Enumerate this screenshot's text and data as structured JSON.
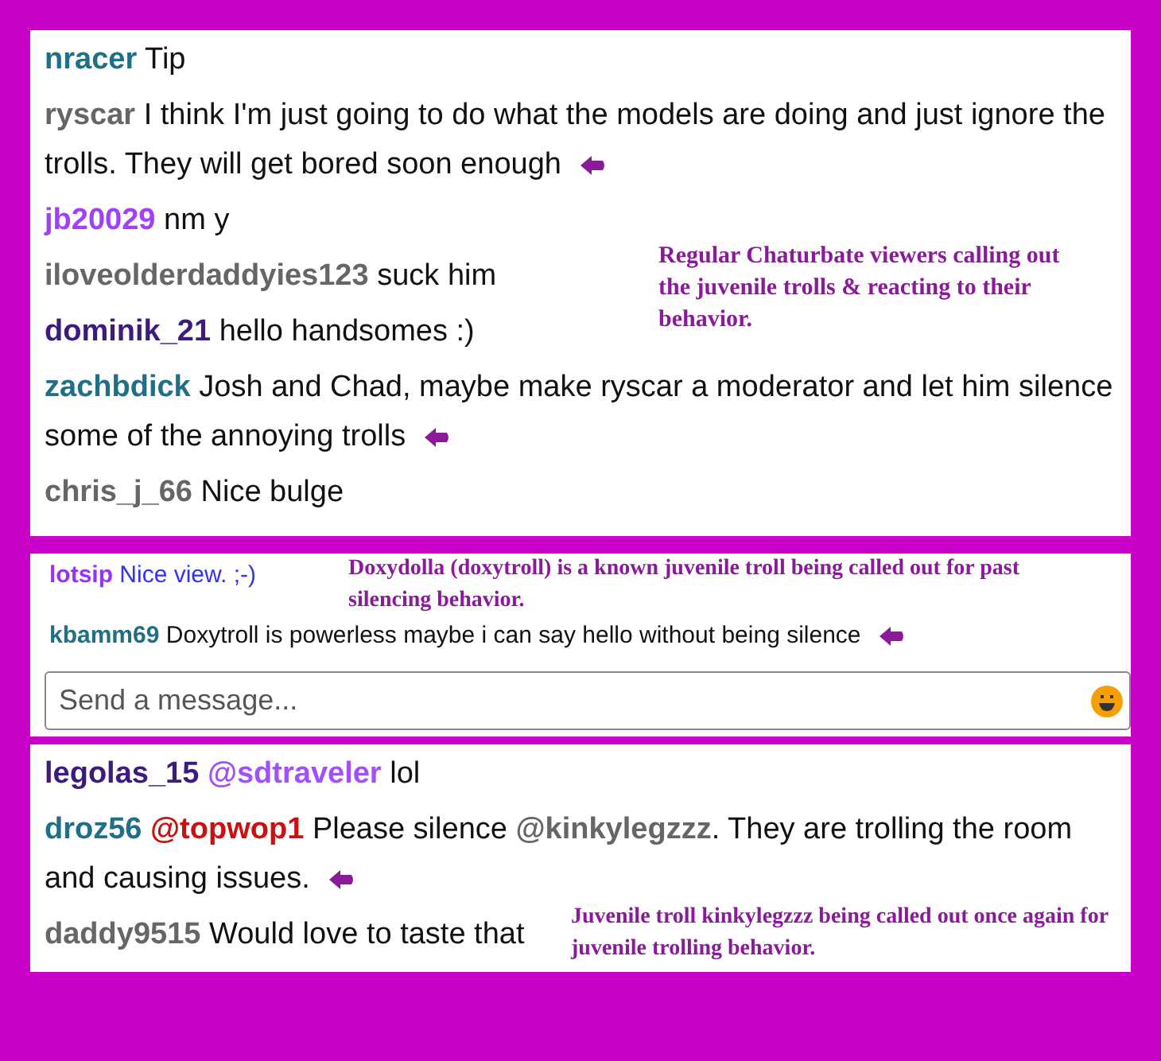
{
  "panels": [
    {
      "messages": [
        {
          "user": "nracer",
          "color": "#1f6f86",
          "parts": [
            {
              "kind": "plain",
              "text": "Tip"
            }
          ],
          "arrow": false
        },
        {
          "user": "ryscar",
          "color": "#666666",
          "parts": [
            {
              "kind": "plain",
              "text": "I think I'm just going to do what the models are doing and just ignore the trolls. They will get bored soon enough"
            }
          ],
          "arrow": true
        },
        {
          "user": "jb20029",
          "color": "#a040ff",
          "parts": [
            {
              "kind": "plain",
              "text": "nm y"
            }
          ],
          "arrow": false
        },
        {
          "user": "iloveolderdaddyies123",
          "color": "#666666",
          "parts": [
            {
              "kind": "plain",
              "text": "suck him"
            }
          ],
          "arrow": false
        },
        {
          "user": "dominik_21",
          "color": "#3d1a80",
          "parts": [
            {
              "kind": "plain",
              "text": "hello handsomes :)"
            }
          ],
          "arrow": false
        },
        {
          "user": "zachbdick",
          "color": "#1f6f86",
          "parts": [
            {
              "kind": "plain",
              "text": "Josh and Chad, maybe make ryscar a moderator and let him silence some of the annoying trolls"
            }
          ],
          "arrow": true
        },
        {
          "user": "chris_j_66",
          "color": "#666666",
          "parts": [
            {
              "kind": "plain",
              "text": "Nice bulge"
            }
          ],
          "arrow": false
        }
      ],
      "note": "Regular Chaturbate viewers calling out the juvenile trolls & reacting to their behavior."
    },
    {
      "messages": [
        {
          "user": "lotsip",
          "color": "#9a30ff",
          "parts": [
            {
              "kind": "colored",
              "text": "Nice view. ;-)",
              "color": "#3030ff"
            }
          ],
          "arrow": false
        },
        {
          "user": "kbamm69",
          "color": "#1f6f86",
          "parts": [
            {
              "kind": "plain",
              "text": "Doxytroll is powerless maybe i can say hello without being silence"
            }
          ],
          "arrow": true
        }
      ],
      "note": "Doxydolla (doxytroll) is a known juvenile troll being called out for past silencing behavior.",
      "input": {
        "placeholder": "Send a message..."
      }
    },
    {
      "messages": [
        {
          "user": "legolas_15",
          "color": "#3d1a80",
          "parts": [
            {
              "kind": "mention",
              "text": "@sdtraveler",
              "color": "#a050ff"
            },
            {
              "kind": "plain",
              "text": "lol"
            }
          ],
          "arrow": false
        },
        {
          "user": "droz56",
          "color": "#1f6f86",
          "parts": [
            {
              "kind": "mention",
              "text": "@topwop1",
              "color": "#cc1010"
            },
            {
              "kind": "plain",
              "text": "Please silence"
            },
            {
              "kind": "mention",
              "text": "@kinkylegzzz",
              "color": "#666666"
            },
            {
              "kind": "plain",
              "text": ". They are trolling the room and causing issues."
            }
          ],
          "arrow": true
        },
        {
          "user": "daddy9515",
          "color": "#666666",
          "parts": [
            {
              "kind": "plain",
              "text": "Would love to taste that"
            }
          ],
          "arrow": false
        }
      ],
      "note": "Juvenile troll kinkylegzzz being called out once again for juvenile trolling behavior."
    }
  ]
}
